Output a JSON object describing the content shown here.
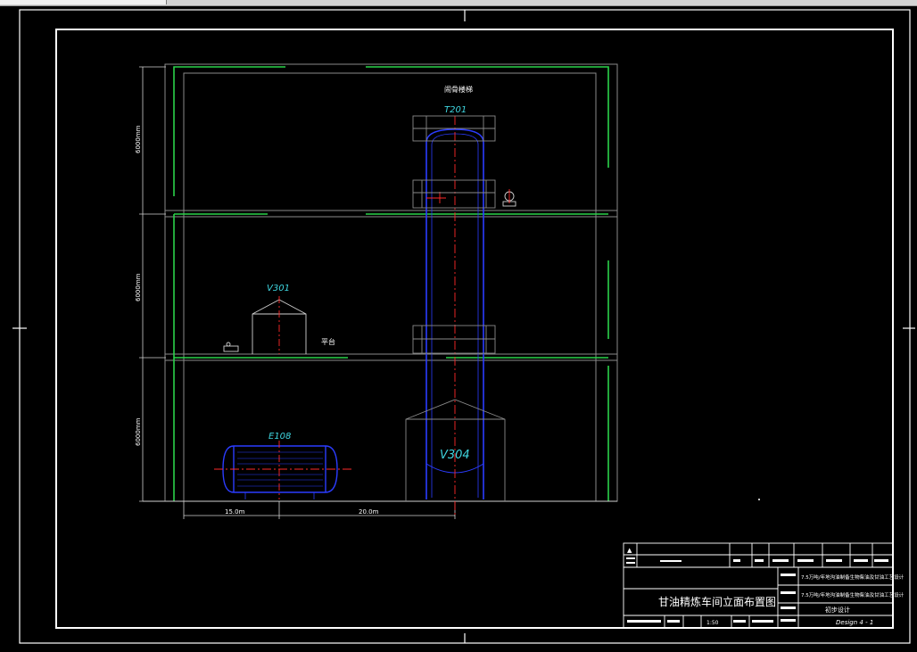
{
  "window": {
    "title": ""
  },
  "drawing": {
    "top_label": "闹骨楼梯",
    "platform_label": "平台",
    "equipment": {
      "t201": "T201",
      "v301": "V301",
      "e108": "E108",
      "v304": "V304"
    },
    "vertical_dims": [
      "6000mm",
      "6000mm",
      "6000mm"
    ],
    "horizontal_dims": [
      "15.0m",
      "20.0m"
    ]
  },
  "title_block": {
    "title": "甘油精炼车间立面布置图",
    "project_line_1": "7.5万吨/年地沟油制备生物柴油及甘油工艺设计",
    "project_line_2": "7.5万吨/年地沟油制备生物柴油及甘油工艺设计",
    "stage": "初步设计",
    "scale": "1:50",
    "drawing_no": "Design 4 - 1"
  },
  "colors": {
    "wall": "#2ad34a",
    "equipment": "#2b3cff",
    "centerline": "#ff2a2a",
    "label": "#3fd6e0",
    "frame": "#ffffff"
  }
}
